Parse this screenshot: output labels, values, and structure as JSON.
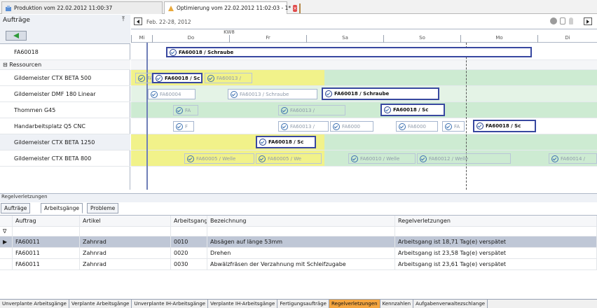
{
  "tabs": [
    {
      "label": "Produktion vom 22.02.2012 11:00:37",
      "icon": "production-icon",
      "active": false
    },
    {
      "label": "Optimierung vom 22.02.2012 11:02:03 - 1*",
      "icon": "optimization-icon",
      "active": true
    }
  ],
  "left_panel": {
    "title": "Aufträge",
    "pin": "⤒",
    "rows": {
      "order": "FA60018",
      "group": "⊟ Ressourcen",
      "r1": "Gildemeister CTX BETA 500",
      "r2": "Gildemeister DMF 180 Linear",
      "r3": "Thommen G45",
      "r4": "Handarbeitsplatz Q5 CNC",
      "r5": "Gildemeister CTX BETA 1250",
      "r6": "Gildemeister CTX BETA 800"
    }
  },
  "gantt": {
    "date_range": "Feb. 22-28, 2012",
    "week": "KW8",
    "days": [
      "Mi",
      "Do",
      "Fr",
      "Sa",
      "So",
      "Mo",
      "Di"
    ],
    "bars": {
      "b_order": "FA60018 / Schraube",
      "r1a": "FA",
      "r1b": "FA60018 / Sc",
      "r1c": "FA60013 /",
      "r2a": "FA60004",
      "r2b": "FA60013 / Schraube",
      "r2c": "FA60018 / Schraube",
      "r3a": "FA",
      "r3b": "FA60013 /",
      "r3c": "FA60018 / Sc",
      "r4a": "F",
      "r4b": "FA60013 /",
      "r4c": "FA6000",
      "r4d": "FA6000",
      "r4e": "FA",
      "r4f": "FA60018 / Sc",
      "r5a": "FA60018 / Sc",
      "r6a": "FA60005 / Welle",
      "r6b": "FA60005 / We",
      "r6c": "FA60010 / Welle",
      "r6d": "FA60012 / Welle",
      "r6e": "FA60014 /"
    }
  },
  "bottom": {
    "title": "Regelverletzungen",
    "subtabs": [
      "Aufträge",
      "Arbeitsgänge",
      "Probleme"
    ],
    "active_subtab": "Arbeitsgänge",
    "columns": [
      "Auftrag",
      "Artikel",
      "Arbeitsgang",
      "Bezeichnung",
      "Regelverletzungen"
    ],
    "filter_icon": "filter-icon",
    "rows": [
      {
        "auftrag": "FA60011",
        "artikel": "Zahnrad",
        "arbeitsgang": "0010",
        "bezeichnung": "Absägen auf länge 53mm",
        "regel": "Arbeitsgang ist 18,71 Tag(e) verspätet",
        "selected": true
      },
      {
        "auftrag": "FA60011",
        "artikel": "Zahnrad",
        "arbeitsgang": "0020",
        "bezeichnung": "Drehen",
        "regel": "Arbeitsgang ist 23,58 Tag(e) verspätet",
        "selected": false
      },
      {
        "auftrag": "FA60011",
        "artikel": "Zahnrad",
        "arbeitsgang": "0030",
        "bezeichnung": "Abwälzfräsen der Verzahnung mit Schleifzugabe",
        "regel": "Arbeitsgang ist 23,61 Tag(e) verspätet",
        "selected": false
      }
    ]
  },
  "footer_tabs": [
    "Unverplante Arbeitsgänge",
    "Verplante Arbeitsgänge",
    "Unverplante IH-Arbeitsgänge",
    "Verplante IH-Arbeitsgänge",
    "Fertigungsaufträge",
    "Regelverletzungen",
    "Kennzahlen",
    "Aufgabenverwaltezschlange"
  ],
  "footer_active": "Regelverletzungen",
  "colors": {
    "accent_tab": "#f5a640",
    "selection_border": "#3848a0",
    "late_zone": "#f1f28a",
    "free_zone": "#cdebd2"
  }
}
